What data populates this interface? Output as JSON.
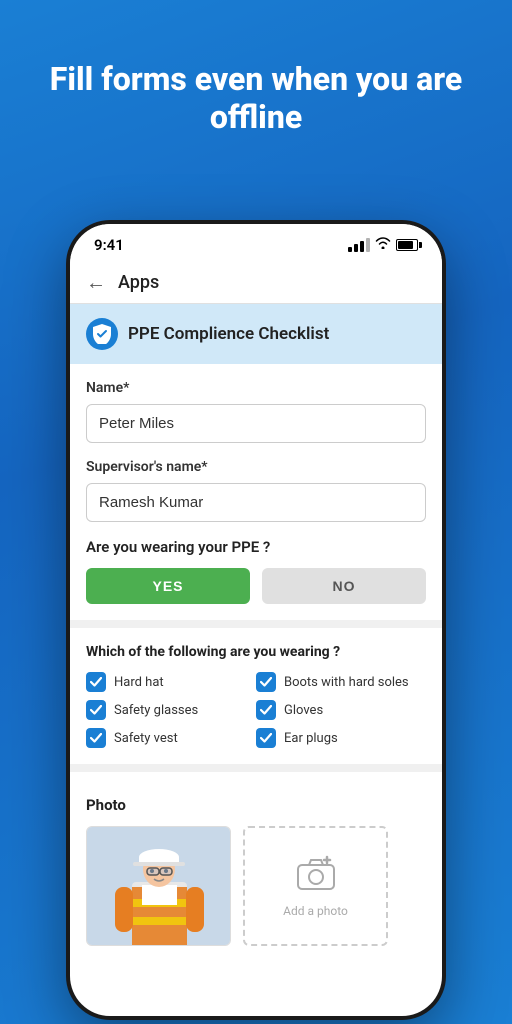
{
  "hero": {
    "title": "Fill forms even when you are offline"
  },
  "status_bar": {
    "time": "9:41"
  },
  "nav": {
    "back_label": "←",
    "title": "Apps"
  },
  "checklist": {
    "header_title": "PPE Complience Checklist",
    "name_label": "Name*",
    "name_value": "Peter Miles",
    "supervisor_label": "Supervisor's name*",
    "supervisor_value": "Ramesh Kumar",
    "ppe_question": "Are you wearing your PPE ?",
    "yes_label": "YES",
    "no_label": "NO",
    "wearing_question": "Which of the following are you wearing ?",
    "items": [
      {
        "label": "Hard hat",
        "checked": true
      },
      {
        "label": "Boots with hard soles",
        "checked": true
      },
      {
        "label": "Safety glasses",
        "checked": true
      },
      {
        "label": "Gloves",
        "checked": true
      },
      {
        "label": "Safety vest",
        "checked": true
      },
      {
        "label": "Ear plugs",
        "checked": true
      }
    ],
    "photo_title": "Photo",
    "add_photo_label": "Add a photo"
  }
}
